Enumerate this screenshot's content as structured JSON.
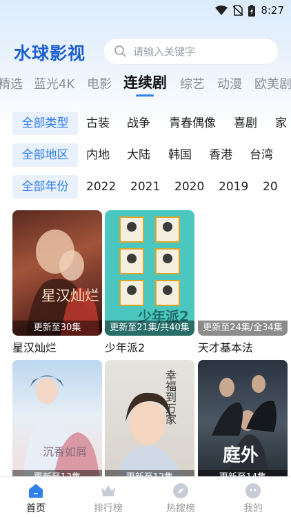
{
  "status_bar": {
    "time": "8:27"
  },
  "header": {
    "logo": "水球影视",
    "search_placeholder": "请输入关键字"
  },
  "tabs": [
    {
      "label": "精选"
    },
    {
      "label": "蓝光4K"
    },
    {
      "label": "电影"
    },
    {
      "label": "连续剧",
      "active": true
    },
    {
      "label": "综艺"
    },
    {
      "label": "动漫"
    },
    {
      "label": "欧美剧"
    }
  ],
  "filters": {
    "type": {
      "selected": "全部类型",
      "options": [
        "古装",
        "战争",
        "青春偶像",
        "喜剧",
        "家"
      ]
    },
    "region": {
      "selected": "全部地区",
      "options": [
        "内地",
        "大陆",
        "韩国",
        "香港",
        "台湾"
      ]
    },
    "year": {
      "selected": "全部年份",
      "options": [
        "2022",
        "2021",
        "2020",
        "2019",
        "20"
      ]
    }
  },
  "shows": [
    {
      "title": "星汉灿烂",
      "badge": "更新至30集",
      "poster_text": "星汉灿烂"
    },
    {
      "title": "少年派2",
      "badge": "更新至21集/共40集",
      "poster_text": "少年派2"
    },
    {
      "title": "天才基本法",
      "badge": "更新至24集/全34集"
    },
    {
      "title": "",
      "badge": "更新至12集",
      "poster_text": "沉香如屑"
    },
    {
      "title": "",
      "badge": "更新至12集",
      "poster_text": "幸福到万家"
    },
    {
      "title": "",
      "badge": "更新至14集",
      "poster_text": "庭外"
    }
  ],
  "bottom_nav": [
    {
      "label": "首页",
      "icon": "home-icon",
      "active": true
    },
    {
      "label": "排行榜",
      "icon": "crown-icon"
    },
    {
      "label": "热搜榜",
      "icon": "compass-icon"
    },
    {
      "label": "我的",
      "icon": "profile-icon"
    }
  ],
  "colors": {
    "accent": "#2f80ed",
    "logo": "#1d5fd1",
    "chip_bg": "#e9f1fc"
  }
}
